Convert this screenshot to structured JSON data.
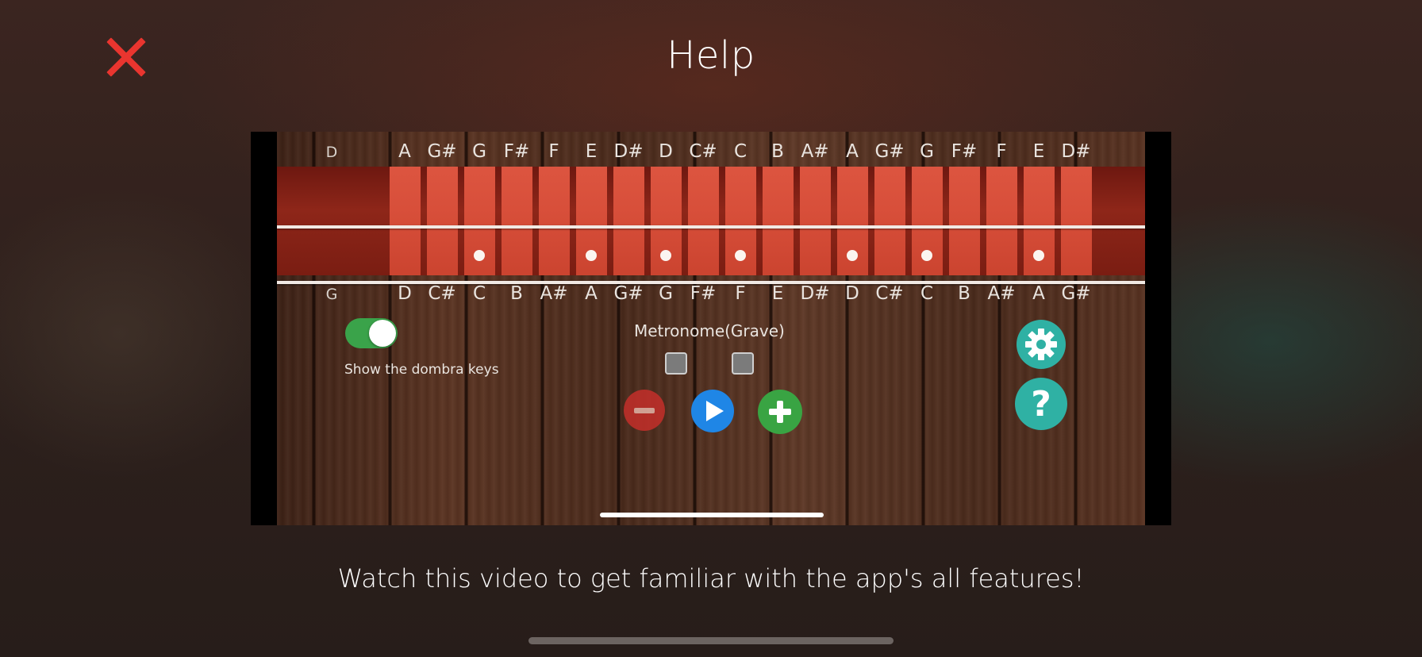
{
  "header": {
    "title": "Help",
    "close_icon": "close-icon"
  },
  "video": {
    "top_notes": [
      "D",
      "A",
      "G#",
      "G",
      "F#",
      "F",
      "E",
      "D#",
      "D",
      "C#",
      "C",
      "B",
      "A#",
      "A",
      "G#",
      "G",
      "F#",
      "F",
      "E",
      "D#"
    ],
    "bottom_notes": [
      "G",
      "D",
      "C#",
      "C",
      "B",
      "A#",
      "A",
      "G#",
      "G",
      "F#",
      "F",
      "E",
      "D#",
      "D",
      "C#",
      "C",
      "B",
      "A#",
      "A",
      "G#"
    ],
    "toggle_label": "Show the dombra keys",
    "toggle_on": true,
    "metronome_label": "Metronome(Grave)",
    "icons": [
      "minus-icon",
      "play-icon",
      "plus-icon",
      "gear-icon",
      "question-icon"
    ],
    "help_glyph": "?"
  },
  "caption": "Watch this video to get familiar with the app's all features!",
  "colors": {
    "close": "#e9352f",
    "teal": "#2fb1a4",
    "play": "#1f86e6",
    "plus": "#39a443",
    "minus": "#c42f2a"
  }
}
